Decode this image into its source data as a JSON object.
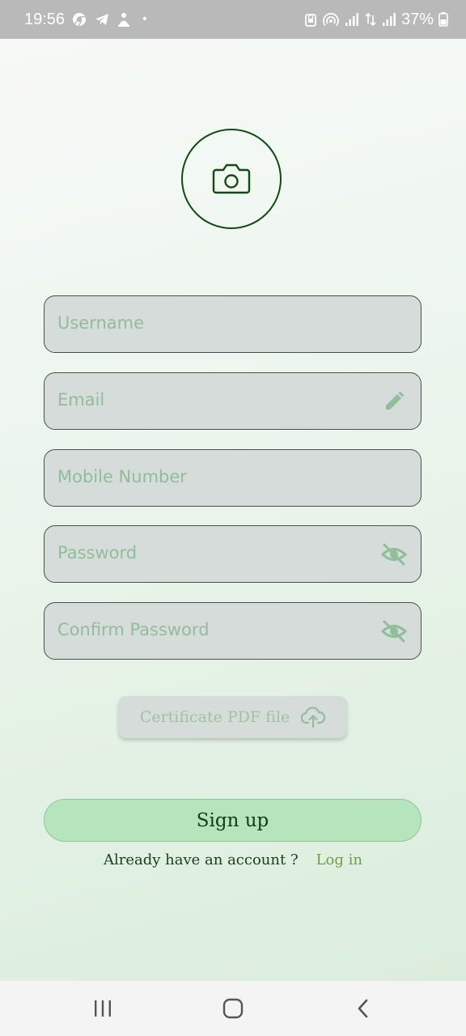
{
  "status_bar": {
    "time": "19:56",
    "dot": "•",
    "battery": "37%"
  },
  "form": {
    "username": {
      "value": "",
      "placeholder": "Username"
    },
    "email": {
      "value": "",
      "placeholder": "Email"
    },
    "mobile": {
      "value": "",
      "placeholder": "Mobile Number"
    },
    "password": {
      "value": "",
      "placeholder": "Password"
    },
    "confirm_password": {
      "value": "",
      "placeholder": "Confirm Password"
    },
    "upload_label": "Certificate PDF file",
    "signup_label": "Sign up",
    "login_prompt": "Already have an account ?",
    "login_link": "Log in"
  },
  "icons": {
    "avatar": "camera-icon",
    "email": "pencil-icon",
    "password": "eye-off-icon",
    "upload": "cloud-upload-icon"
  },
  "colors": {
    "primary_green": "#0e4d12",
    "field_bg": "#d6dcd9",
    "placeholder": "#8fbe99",
    "signup_bg": "#b6e5bd",
    "link": "#6fa33a"
  }
}
